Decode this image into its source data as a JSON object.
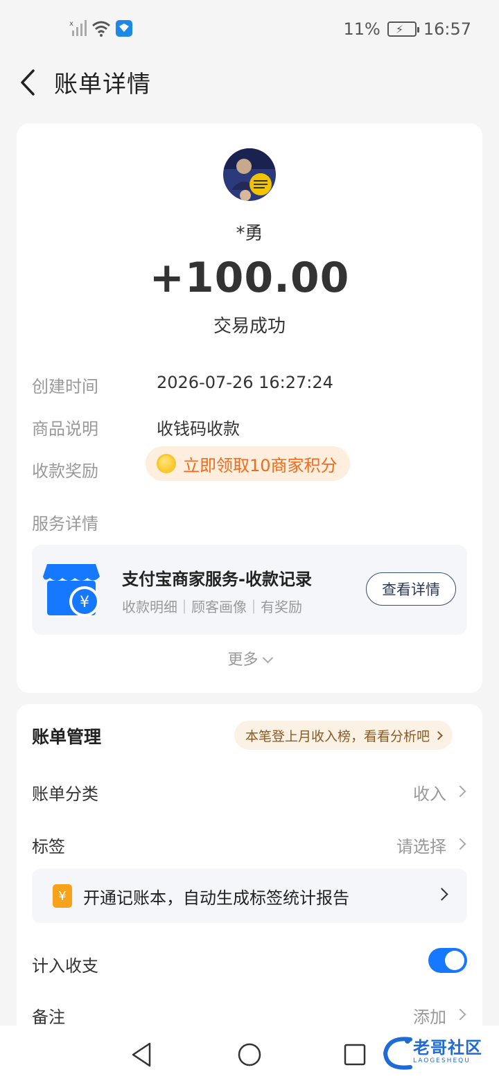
{
  "status_bar": {
    "battery_percent": "11%",
    "time": "16:57"
  },
  "header": {
    "title": "账单详情"
  },
  "transaction": {
    "counterparty": "*勇",
    "amount": "+100.00",
    "status": "交易成功",
    "details": [
      {
        "label": "创建时间",
        "value": "2026-07-26 16:27:24"
      },
      {
        "label": "商品说明",
        "value": "收钱码收款"
      }
    ],
    "reward_label": "收款奖励",
    "reward_text": "立即领取10商家积分",
    "service_label": "服务详情"
  },
  "service": {
    "title": "支付宝商家服务-收款记录",
    "subtitle": "收款明细｜顾客画像｜有奖励",
    "button": "查看详情"
  },
  "more_label": "更多",
  "management": {
    "title": "账单管理",
    "promo_pill": "本笔登上月收入榜，看看分析吧",
    "rows": [
      {
        "label": "账单分类",
        "value": "收入"
      },
      {
        "label": "标签",
        "value": "请选择"
      }
    ],
    "bookkeeping_icon": "¥",
    "bookkeeping_text": "开通记账本，自动生成标签统计报告",
    "include_label": "计入收支",
    "include_enabled": true,
    "note_label": "备注",
    "note_value": "添加"
  },
  "watermark": {
    "text": "老哥社区",
    "sub": "LAOGESHEQU"
  },
  "colors": {
    "accent": "#1677ff",
    "reward": "#f26b1d",
    "background": "#f5f5f5"
  },
  "icons": [
    "signal-icon",
    "wifi-icon",
    "app-notification-icon",
    "battery-icon",
    "back-arrow-icon",
    "coin-icon",
    "shop-icon",
    "chevron-down-icon",
    "chevron-right-icon",
    "bookkeeping-icon"
  ]
}
